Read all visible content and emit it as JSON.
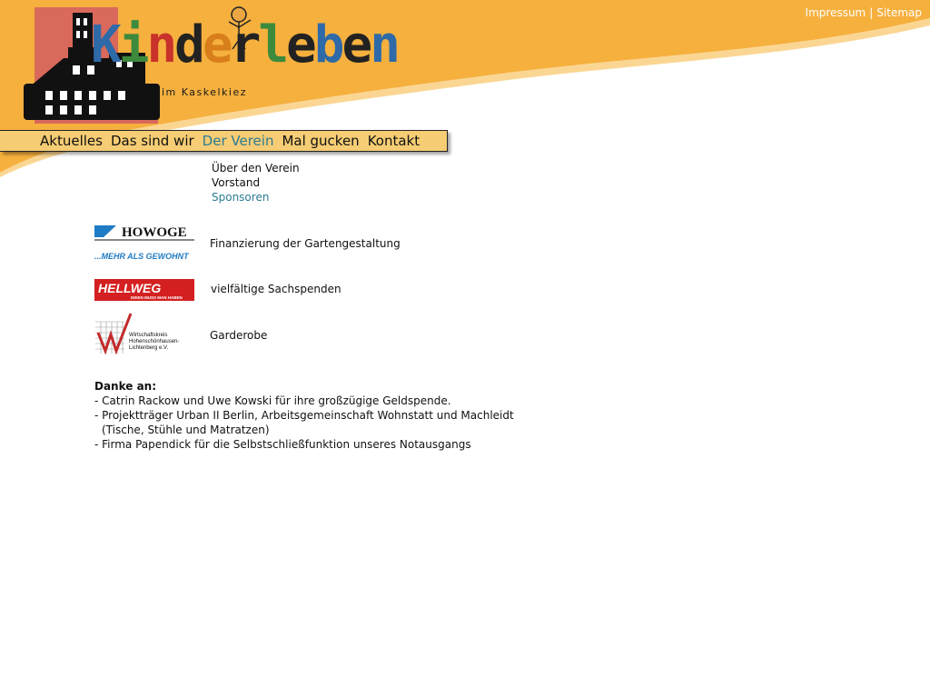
{
  "toplinks": {
    "impressum": "Impressum",
    "separator": "|",
    "sitemap": "Sitemap"
  },
  "logo": {
    "wordmark": [
      "K",
      "i",
      "n",
      "d",
      "e",
      "r",
      "l",
      "e",
      "b",
      "e",
      "n"
    ],
    "tagline": "im Kaskelkiez"
  },
  "nav": {
    "items": [
      {
        "label": "Aktuelles",
        "active": false
      },
      {
        "label": "Das sind wir",
        "active": false
      },
      {
        "label": "Der Verein",
        "active": true
      },
      {
        "label": "Mal gucken",
        "active": false
      },
      {
        "label": "Kontakt",
        "active": false
      }
    ]
  },
  "subnav": {
    "items": [
      {
        "label": "Über den Verein",
        "active": false
      },
      {
        "label": "Vorstand",
        "active": false
      },
      {
        "label": "Sponsoren",
        "active": true
      }
    ]
  },
  "sponsors": [
    {
      "logo_name": "HOWOGE",
      "logo_slogan": "...MEHR ALS GEWOHNT",
      "text": "Finanzierung der Gartengestaltung"
    },
    {
      "logo_name": "HELLWEG",
      "logo_slogan": "IDEEN MUSS MAN HABEN",
      "text": "vielfältige Sachspenden"
    },
    {
      "logo_name": "Wirtschaftskreis Hohenschönhausen-Lichtenberg e.V.",
      "logo_lines": [
        "Wirtschaftskreis",
        "Hohenschönhausen-",
        "Lichtenberg e.V."
      ],
      "text": "Garderobe"
    }
  ],
  "thanks": {
    "heading": "Danke an:",
    "lines": [
      "- Catrin Rackow und Uwe Kowski für ihre großzügige Geldspende.",
      "- Projektträger Urban II Berlin, Arbeitsgemeinschaft Wohnstatt und Machleidt",
      "(Tische, Stühle und Matratzen)",
      "- Firma Papendick für die Selbstschließfunktion unseres Notausgangs"
    ]
  },
  "colors": {
    "header_orange": "#f5b03e",
    "nav_bg": "#f6cd74",
    "active_link": "#2c7a94"
  }
}
